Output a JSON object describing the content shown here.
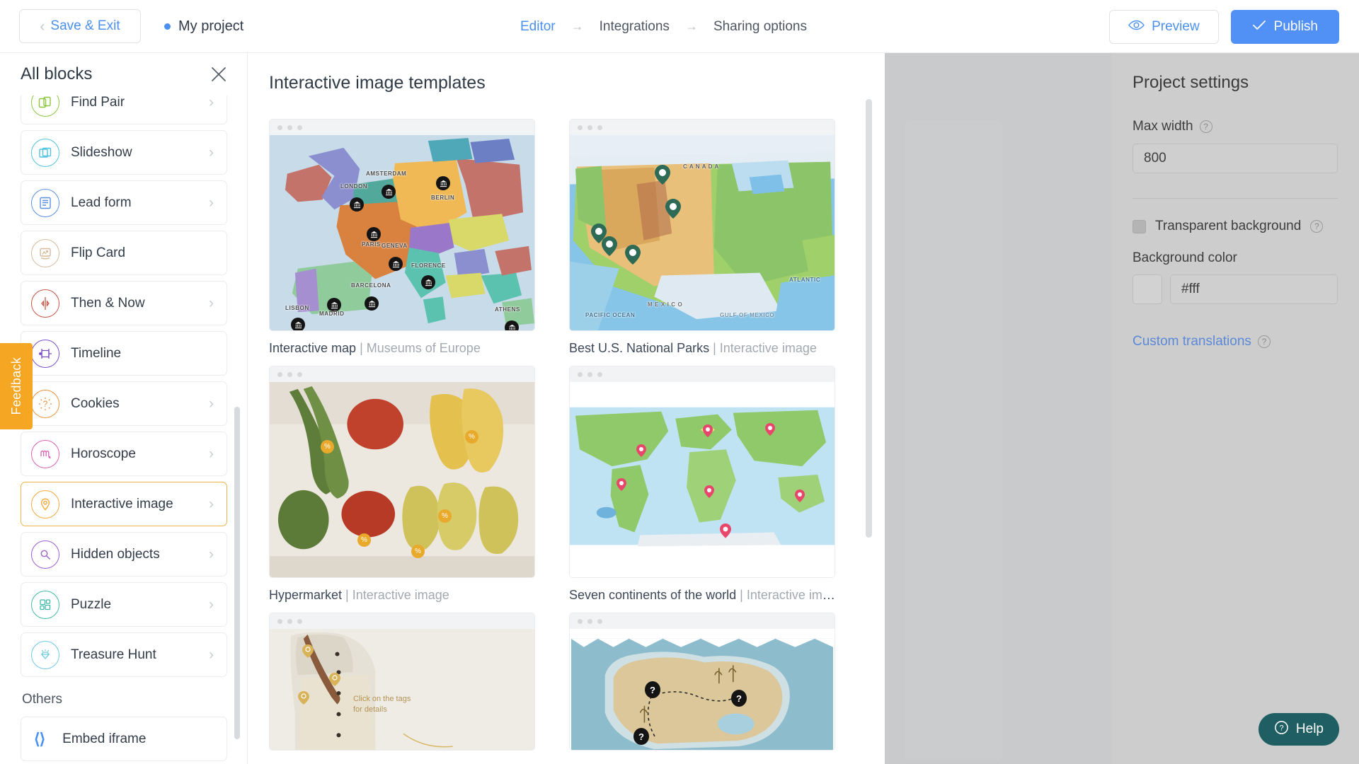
{
  "topbar": {
    "save_exit_label": "Save & Exit",
    "back_chevron_icon": "chevron-left-icon",
    "project_status_dot": "status-dot-icon",
    "project_name": "My project",
    "breadcrumb": [
      {
        "label": "Editor",
        "active": true
      },
      {
        "label": "Integrations",
        "active": false
      },
      {
        "label": "Sharing options",
        "active": false
      }
    ],
    "breadcrumb_arrow": "→",
    "preview_label": "Preview",
    "preview_icon": "eye-icon",
    "publish_label": "Publish",
    "publish_icon": "check-icon",
    "publish_color": "#5190f5",
    "link_color": "#4a90f0"
  },
  "sidebar": {
    "title": "All blocks",
    "close_icon": "close-icon",
    "items": [
      {
        "label": "Find Pair",
        "icon": "find-pair-icon",
        "color": "#8cc63f",
        "selected": false
      },
      {
        "label": "Slideshow",
        "icon": "slideshow-icon",
        "color": "#4ec3e0",
        "selected": false
      },
      {
        "label": "Lead form",
        "icon": "lead-form-icon",
        "color": "#5b8fe0",
        "selected": false
      },
      {
        "label": "Flip Card",
        "icon": "flip-card-icon",
        "color": "#d6bb9a",
        "selected": false
      },
      {
        "label": "Then & Now",
        "icon": "then-and-now-icon",
        "color": "#c65642",
        "selected": false
      },
      {
        "label": "Timeline",
        "icon": "timeline-icon",
        "color": "#7b4fc9",
        "selected": false
      },
      {
        "label": "Cookies",
        "icon": "cookies-icon",
        "color": "#e9913a",
        "selected": false
      },
      {
        "label": "Horoscope",
        "icon": "horoscope-icon",
        "color": "#d962b6",
        "selected": false
      },
      {
        "label": "Interactive image",
        "icon": "interactive-image-icon",
        "color": "#f0a93c",
        "selected": true
      },
      {
        "label": "Hidden objects",
        "icon": "hidden-objects-icon",
        "color": "#9b5fd0",
        "selected": false
      },
      {
        "label": "Puzzle",
        "icon": "puzzle-icon",
        "color": "#3fb8a8",
        "selected": false
      },
      {
        "label": "Treasure Hunt",
        "icon": "treasure-hunt-icon",
        "color": "#6ec9e8",
        "selected": false
      }
    ],
    "chevron_icon": "chevron-right-icon",
    "others_label": "Others",
    "embed_label": "Embed iframe",
    "embed_icon": "code-brackets-icon",
    "selected_border_color": "#f0b44c"
  },
  "feedback": {
    "label": "Feedback",
    "color": "#f5a623"
  },
  "templates": {
    "title": "Interactive image templates",
    "cards": [
      {
        "name": "Interactive map",
        "type": "Museums of Europe",
        "thumb": "europe-museums-map"
      },
      {
        "name": "Best U.S. National Parks",
        "type": "Interactive image",
        "thumb": "usa-parks-map"
      },
      {
        "name": "Hypermarket",
        "type": "Interactive image",
        "thumb": "hypermarket-produce"
      },
      {
        "name": "Seven continents of the world",
        "type": "Interactive ima…",
        "thumb": "world-continents-map"
      },
      {
        "name": "",
        "type": "",
        "thumb": "fashion-tags"
      },
      {
        "name": "",
        "type": "",
        "thumb": "treasure-island-map"
      }
    ],
    "europe_map_labels": [
      "LONDON",
      "AMSTERDAM",
      "BERLIN",
      "PARIS",
      "GENEVA",
      "FLORENCE",
      "BARCELONA",
      "LISBON",
      "MADRID",
      "ATHENS"
    ],
    "fashion_hint": "Click on the tags\nfor details"
  },
  "settings": {
    "title": "Project settings",
    "max_width_label": "Max width",
    "max_width_value": "800",
    "max_width_help_icon": "help-icon",
    "transparent_bg_label": "Transparent background",
    "transparent_bg_checked": false,
    "transparent_bg_help_icon": "help-icon",
    "background_color_label": "Background color",
    "background_color_value": "#fff",
    "custom_translations_label": "Custom translations",
    "custom_translations_help_icon": "help-icon",
    "link_color": "#5b89d8"
  },
  "help_widget": {
    "label": "Help",
    "icon": "question-circle-icon",
    "color": "#1f5f63"
  }
}
